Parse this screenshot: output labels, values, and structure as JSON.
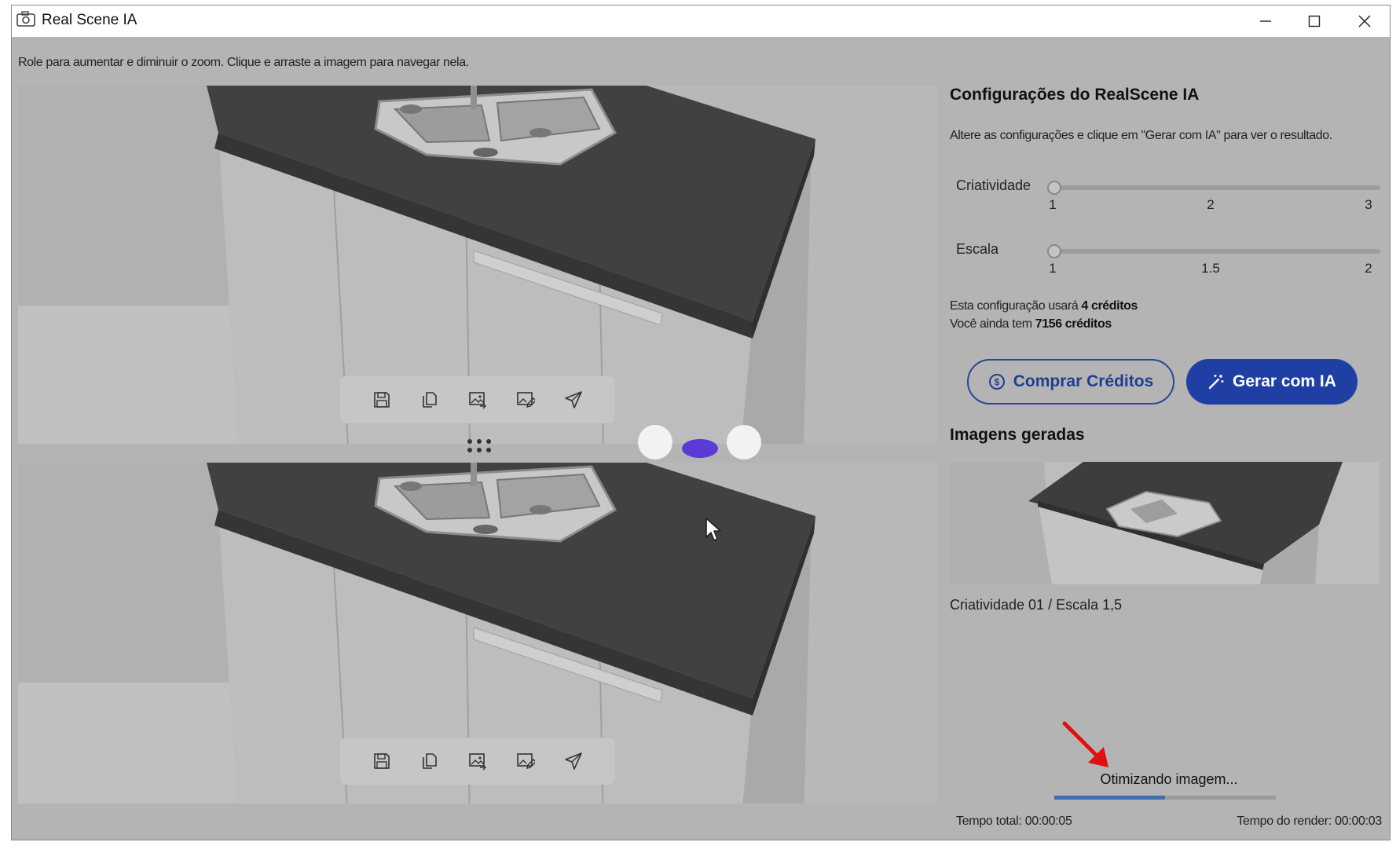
{
  "window": {
    "title": "Real Scene IA",
    "controls": [
      "minimize-icon",
      "maximize-icon",
      "close-icon"
    ]
  },
  "viewer": {
    "hint": "Role para aumentar e diminuir o zoom. Clique e arraste a imagem para navegar nela.",
    "toolbar_icons": [
      "save-icon",
      "copy-icon",
      "image-export-icon",
      "image-edit-icon",
      "send-icon"
    ]
  },
  "panel": {
    "title": "Configurações do RealScene IA",
    "subtitle": "Altere as configurações e clique em \"Gerar com IA\" para ver o resultado.",
    "sliders": [
      {
        "label": "Criatividade",
        "ticks": [
          "1",
          "2",
          "3"
        ],
        "min": 1,
        "max": 3,
        "value": 1
      },
      {
        "label": "Escala",
        "ticks": [
          "1",
          "1.5",
          "2"
        ],
        "min": 1,
        "max": 2,
        "value": 1
      }
    ],
    "credits": {
      "line1_prefix": "Esta configuração usará ",
      "line1_value": "4 créditos",
      "line2_prefix": "Você ainda tem ",
      "line2_value": "7156 créditos"
    },
    "buy_button": "Comprar Créditos",
    "generate_button": "Gerar com IA",
    "generated_title": "Imagens geradas",
    "generated_items": [
      {
        "caption": "Criatividade 01 / Escala 1,5"
      }
    ],
    "status_text": "Otimizando imagem...",
    "progress": 0.5,
    "time_total": "Tempo total: 00:00:05",
    "time_render": "Tempo do render: 00:00:03"
  },
  "colors": {
    "accent": "#1f3fa5",
    "loader_dot": "#5b3bd6",
    "annotation_arrow": "#e01010",
    "progress_fill": "#3a6fb0"
  }
}
